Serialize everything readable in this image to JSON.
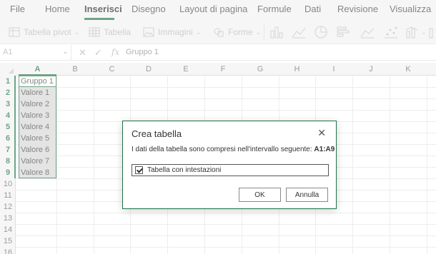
{
  "menu": {
    "tabs": [
      {
        "label": "File"
      },
      {
        "label": "Home"
      },
      {
        "label": "Inserisci"
      },
      {
        "label": "Disegno"
      },
      {
        "label": "Layout di pagina"
      },
      {
        "label": "Formule"
      },
      {
        "label": "Dati"
      },
      {
        "label": "Revisione"
      },
      {
        "label": "Visualizza"
      }
    ],
    "active": "Inserisci"
  },
  "ribbon": {
    "pivot_label": "Tabella pivot",
    "table_label": "Tabella",
    "images_label": "Immagini",
    "shapes_label": "Forme"
  },
  "formula_bar": {
    "name_box": "A1",
    "fx": "fx",
    "content": "Gruppo 1"
  },
  "grid": {
    "columns": [
      "A",
      "B",
      "C",
      "D",
      "E",
      "F",
      "G",
      "H",
      "I",
      "J",
      "K"
    ],
    "rows": [
      "1",
      "2",
      "3",
      "4",
      "5",
      "6",
      "7",
      "8",
      "9",
      "10",
      "11",
      "12",
      "13",
      "14",
      "15",
      "16"
    ],
    "column_a_values": [
      "Gruppo 1",
      "Valore 1",
      "Valore 2",
      "Valore 3",
      "Valore 4",
      "Valore 5",
      "Valore 6",
      "Valore 7",
      "Valore 8"
    ]
  },
  "dialog": {
    "title": "Crea tabella",
    "message": "I dati della tabella sono compresi nell'intervallo seguente:",
    "range": "A1:A9",
    "checkbox_label": "Tabella con intestazioni",
    "checkbox_checked": true,
    "ok_label": "OK",
    "cancel_label": "Annulla"
  },
  "colors": {
    "accent": "#217346"
  }
}
